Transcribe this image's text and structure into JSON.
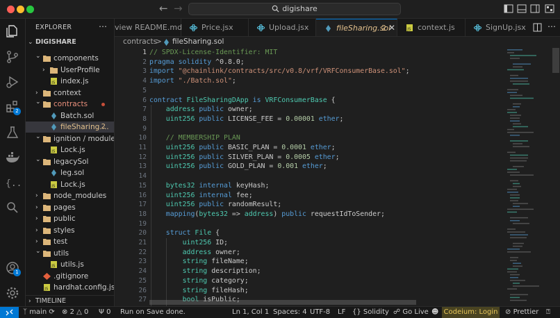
{
  "titlebar": {
    "search_text": "digishare"
  },
  "activity": {
    "extensions_badge": "2",
    "accounts_badge": "1"
  },
  "sidebar": {
    "title": "EXPLORER",
    "project": "DIGISHARE",
    "tree": [
      {
        "label": "components",
        "kind": "folder-open",
        "indent": 1
      },
      {
        "label": "UserProfile",
        "kind": "folder",
        "indent": 2
      },
      {
        "label": "index.js",
        "kind": "js",
        "indent": 2
      },
      {
        "label": "context",
        "kind": "folder",
        "indent": 1
      },
      {
        "label": "contracts",
        "kind": "folder-open",
        "indent": 1,
        "modified": true
      },
      {
        "label": "Batch.sol",
        "kind": "sol",
        "indent": 2
      },
      {
        "label": "fileSharing....",
        "kind": "sol",
        "indent": 2,
        "selected": true,
        "count": "2"
      },
      {
        "label": "ignition / modules",
        "kind": "folder-open",
        "indent": 1
      },
      {
        "label": "Lock.js",
        "kind": "js",
        "indent": 2
      },
      {
        "label": "legacySol",
        "kind": "folder-open",
        "indent": 1
      },
      {
        "label": "leg.sol",
        "kind": "sol",
        "indent": 2
      },
      {
        "label": "Lock.js",
        "kind": "js",
        "indent": 2
      },
      {
        "label": "node_modules",
        "kind": "folder",
        "indent": 1
      },
      {
        "label": "pages",
        "kind": "folder",
        "indent": 1
      },
      {
        "label": "public",
        "kind": "folder",
        "indent": 1
      },
      {
        "label": "styles",
        "kind": "folder",
        "indent": 1
      },
      {
        "label": "test",
        "kind": "folder",
        "indent": 1
      },
      {
        "label": "utils",
        "kind": "folder-open",
        "indent": 1
      },
      {
        "label": "utils.js",
        "kind": "js",
        "indent": 2
      },
      {
        "label": ".gitignore",
        "kind": "git",
        "indent": 1
      },
      {
        "label": "hardhat.config.js",
        "kind": "js",
        "indent": 1
      }
    ],
    "timeline": "TIMELINE"
  },
  "tabs": [
    {
      "label": "view README.md",
      "icon": ""
    },
    {
      "label": "Price.jsx",
      "icon": "react"
    },
    {
      "label": "Upload.jsx",
      "icon": "react"
    },
    {
      "label": "fileSharing.sol",
      "icon": "sol",
      "active": true,
      "count": "2",
      "close": "✕"
    },
    {
      "label": "context.js",
      "icon": "js"
    },
    {
      "label": "SignUp.jsx",
      "icon": "react"
    }
  ],
  "breadcrumb": {
    "folder": "contracts",
    "separator": ">",
    "file": "fileSharing.sol"
  },
  "editor": {
    "current_line": 1,
    "lines": [
      [
        [
          "c-com",
          "// SPDX-License-Identifier: MIT"
        ]
      ],
      [
        [
          "c-kw",
          "pragma solidity "
        ],
        [
          "c-def",
          "^0.8.0;"
        ]
      ],
      [
        [
          "c-kw",
          "import "
        ],
        [
          "c-str",
          "\"@chainlink/contracts/src/v0.8/vrf/VRFConsumerBase.sol\""
        ],
        [
          "c-def",
          ";"
        ]
      ],
      [
        [
          "c-kw",
          "import "
        ],
        [
          "c-str",
          "\"./Batch.sol\""
        ],
        [
          "c-def",
          ";"
        ]
      ],
      [
        [
          "c-def",
          ""
        ]
      ],
      [
        [
          "c-kw",
          "contract "
        ],
        [
          "c-type",
          "FileSharingDApp "
        ],
        [
          "c-kw",
          "is "
        ],
        [
          "c-type",
          "VRFConsumerBase "
        ],
        [
          "c-def",
          "{"
        ]
      ],
      [
        [
          "c-def",
          "    "
        ],
        [
          "c-type",
          "address "
        ],
        [
          "c-kw",
          "public "
        ],
        [
          "c-def",
          "owner;"
        ]
      ],
      [
        [
          "c-def",
          "    "
        ],
        [
          "c-type",
          "uint256 "
        ],
        [
          "c-kw",
          "public "
        ],
        [
          "c-def",
          "LICENSE_FEE = "
        ],
        [
          "c-num",
          "0.00001 "
        ],
        [
          "c-kw",
          "ether"
        ],
        [
          "c-def",
          ";"
        ]
      ],
      [
        [
          "c-def",
          ""
        ]
      ],
      [
        [
          "c-def",
          "    "
        ],
        [
          "c-com",
          "// MEMBERSHIP PLAN"
        ]
      ],
      [
        [
          "c-def",
          "    "
        ],
        [
          "c-type",
          "uint256 "
        ],
        [
          "c-kw",
          "public "
        ],
        [
          "c-def",
          "BASIC_PLAN = "
        ],
        [
          "c-num",
          "0.0001 "
        ],
        [
          "c-kw",
          "ether"
        ],
        [
          "c-def",
          ";"
        ]
      ],
      [
        [
          "c-def",
          "    "
        ],
        [
          "c-type",
          "uint256 "
        ],
        [
          "c-kw",
          "public "
        ],
        [
          "c-def",
          "SILVER_PLAN = "
        ],
        [
          "c-num",
          "0.0005 "
        ],
        [
          "c-kw",
          "ether"
        ],
        [
          "c-def",
          ";"
        ]
      ],
      [
        [
          "c-def",
          "    "
        ],
        [
          "c-type",
          "uint256 "
        ],
        [
          "c-kw",
          "public "
        ],
        [
          "c-def",
          "GOLD_PLAN = "
        ],
        [
          "c-num",
          "0.001 "
        ],
        [
          "c-kw",
          "ether"
        ],
        [
          "c-def",
          ";"
        ]
      ],
      [
        [
          "c-def",
          ""
        ]
      ],
      [
        [
          "c-def",
          "    "
        ],
        [
          "c-type",
          "bytes32 "
        ],
        [
          "c-kw",
          "internal "
        ],
        [
          "c-def",
          "keyHash;"
        ]
      ],
      [
        [
          "c-def",
          "    "
        ],
        [
          "c-type",
          "uint256 "
        ],
        [
          "c-kw",
          "internal "
        ],
        [
          "c-def",
          "fee;"
        ]
      ],
      [
        [
          "c-def",
          "    "
        ],
        [
          "c-type",
          "uint256 "
        ],
        [
          "c-kw",
          "public "
        ],
        [
          "c-def",
          "randomResult;"
        ]
      ],
      [
        [
          "c-def",
          "    "
        ],
        [
          "c-kw",
          "mapping"
        ],
        [
          "c-def",
          "("
        ],
        [
          "c-type",
          "bytes32 "
        ],
        [
          "c-def",
          "=> "
        ],
        [
          "c-type",
          "address"
        ],
        [
          "c-def",
          ") "
        ],
        [
          "c-kw",
          "public "
        ],
        [
          "c-def",
          "requestIdToSender;"
        ]
      ],
      [
        [
          "c-def",
          ""
        ]
      ],
      [
        [
          "c-def",
          "    "
        ],
        [
          "c-kw",
          "struct "
        ],
        [
          "c-type",
          "File "
        ],
        [
          "c-def",
          "{"
        ]
      ],
      [
        [
          "c-def",
          "        "
        ],
        [
          "c-type",
          "uint256 "
        ],
        [
          "c-def",
          "ID;"
        ]
      ],
      [
        [
          "c-def",
          "        "
        ],
        [
          "c-type",
          "address "
        ],
        [
          "c-def",
          "owner;"
        ]
      ],
      [
        [
          "c-def",
          "        "
        ],
        [
          "c-type",
          "string "
        ],
        [
          "c-def",
          "fileName;"
        ]
      ],
      [
        [
          "c-def",
          "        "
        ],
        [
          "c-type",
          "string "
        ],
        [
          "c-def",
          "description;"
        ]
      ],
      [
        [
          "c-def",
          "        "
        ],
        [
          "c-type",
          "string "
        ],
        [
          "c-def",
          "category;"
        ]
      ],
      [
        [
          "c-def",
          "        "
        ],
        [
          "c-type",
          "string "
        ],
        [
          "c-def",
          "fileHash;"
        ]
      ],
      [
        [
          "c-def",
          "        "
        ],
        [
          "c-type",
          "bool "
        ],
        [
          "c-def",
          "isPublic;"
        ]
      ]
    ]
  },
  "statusbar": {
    "branch": "main",
    "errors": "2",
    "warnings": "0",
    "ports": "0",
    "run_on_save": "Run on Save done.",
    "cursor": "Ln 1, Col 1",
    "spaces": "Spaces: 4",
    "encoding": "UTF-8",
    "eol": "LF",
    "language": "Solidity",
    "go_live": "Go Live",
    "codeium": "Codeium: Login",
    "prettier": "Prettier"
  },
  "colors": {
    "accent": "#0078d4",
    "sol_icon": "#519aba",
    "react_icon": "#61dafb",
    "js_icon": "#cbcb41",
    "folder": "#dcb67a"
  }
}
